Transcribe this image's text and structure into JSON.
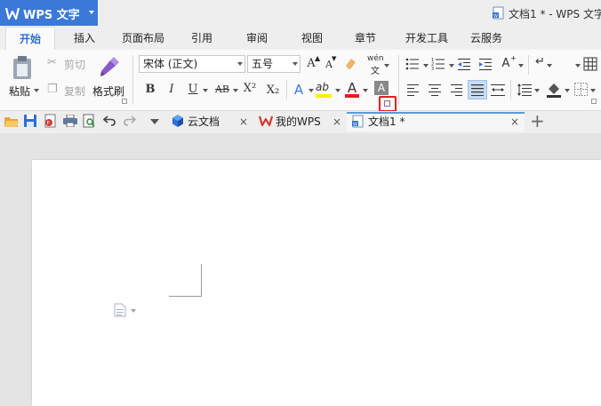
{
  "titlebar": {
    "app_name": "WPS 文字",
    "window_title": "文档1 * - WPS 文字"
  },
  "menu": {
    "tabs": [
      "开始",
      "插入",
      "页面布局",
      "引用",
      "审阅",
      "视图",
      "章节",
      "开发工具",
      "云服务"
    ],
    "active": "开始"
  },
  "clipboard": {
    "paste": "粘贴",
    "cut": "剪切",
    "copy": "复制",
    "format_painter": "格式刷"
  },
  "font": {
    "name": "宋体 (正文)",
    "size": "五号",
    "bold": "B",
    "italic": "I",
    "underline": "U",
    "strikethrough": "AB",
    "superscript": "X²",
    "subscript": "X₂",
    "text_effect": "A",
    "highlight": "ab",
    "font_color": "A",
    "char_shading": "A",
    "grow": "A",
    "shrink": "A",
    "pinyin": "wén"
  },
  "doc_tabs": {
    "cloud_docs": "云文档",
    "my_wps": "我的WPS",
    "active_doc": "文档1 *",
    "close": "×",
    "new_tab": "+"
  },
  "colors": {
    "accent": "#3b78d8",
    "highlight_red": "#e02020",
    "highlight_yellow": "#ffee00",
    "font_color_red": "#e02020"
  }
}
